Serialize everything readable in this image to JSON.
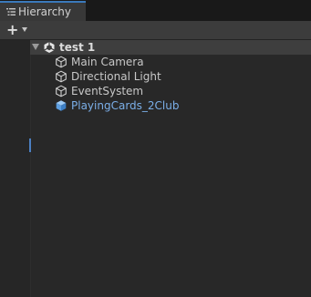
{
  "window": {
    "tab_label": "Hierarchy",
    "accent_color": "#3a79bb"
  },
  "toolbar": {
    "create_label": "+"
  },
  "scene": {
    "name": "test 1",
    "items": [
      {
        "label": "Main Camera",
        "icon": "gameobject-cube-icon",
        "type": "gameobject"
      },
      {
        "label": "Directional Light",
        "icon": "gameobject-cube-icon",
        "type": "gameobject"
      },
      {
        "label": "EventSystem",
        "icon": "gameobject-cube-icon",
        "type": "gameobject"
      },
      {
        "label": "PlayingCards_2Club",
        "icon": "prefab-cube-icon",
        "type": "prefab",
        "color": "#7bafe8"
      }
    ]
  }
}
